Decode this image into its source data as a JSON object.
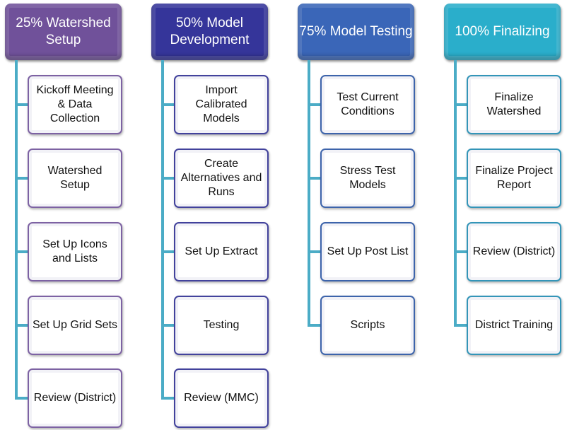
{
  "phases": [
    {
      "title": "25% Watershed Setup",
      "color": "#70519a",
      "border": "#7d62a3",
      "tasks": [
        "Kickoff Meeting & Data Collection",
        "Watershed Setup",
        "Set Up Icons and Lists",
        "Set Up Grid Sets",
        "Review (District)"
      ]
    },
    {
      "title": "50% Model Development",
      "color": "#35359a",
      "border": "#42429c",
      "tasks": [
        "Import Calibrated Models",
        "Create Alternatives and Runs",
        "Set Up Extract",
        "Testing",
        "Review (MMC)"
      ]
    },
    {
      "title": "75% Model Testing",
      "color": "#3a66b8",
      "border": "#3d64ab",
      "tasks": [
        "Test Current Conditions",
        "Stress Test Models",
        "Set Up Post List",
        "Scripts"
      ]
    },
    {
      "title": "100% Finalizing",
      "color": "#2aaecb",
      "border": "#3395b8",
      "tasks": [
        "Finalize Watershed",
        "Finalize Project Report",
        "Review (District)",
        "District Training"
      ]
    }
  ]
}
